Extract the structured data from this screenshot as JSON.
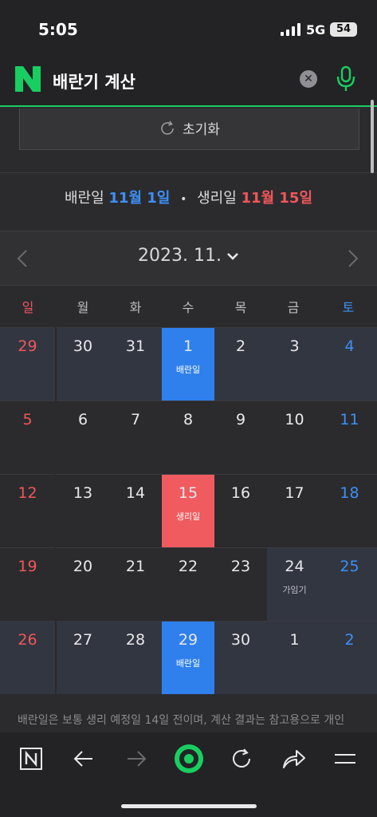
{
  "status": {
    "time": "5:05",
    "network": "5G",
    "battery": "54"
  },
  "search": {
    "query": "배란기 계산",
    "clear_icon": "close-icon",
    "mic_icon": "microphone-icon"
  },
  "reset": {
    "label": "초기화"
  },
  "summary": {
    "ovulation_prefix": "배란일",
    "ovulation_date": "11월 1일",
    "separator": "•",
    "period_prefix": "생리일",
    "period_date": "11월 15일"
  },
  "calendar": {
    "month": "2023. 11.",
    "weekdays": [
      "일",
      "월",
      "화",
      "수",
      "목",
      "금",
      "토"
    ],
    "weeks": [
      [
        {
          "d": "29",
          "out": true
        },
        {
          "d": "30",
          "out": true
        },
        {
          "d": "31",
          "out": true
        },
        {
          "d": "1",
          "mark": "ovu",
          "label": "배란일"
        },
        {
          "d": "2",
          "out": true
        },
        {
          "d": "3",
          "out": true
        },
        {
          "d": "4",
          "out": true
        }
      ],
      [
        {
          "d": "5"
        },
        {
          "d": "6"
        },
        {
          "d": "7"
        },
        {
          "d": "8"
        },
        {
          "d": "9"
        },
        {
          "d": "10"
        },
        {
          "d": "11"
        }
      ],
      [
        {
          "d": "12"
        },
        {
          "d": "13"
        },
        {
          "d": "14"
        },
        {
          "d": "15",
          "mark": "period",
          "label": "생리일"
        },
        {
          "d": "16"
        },
        {
          "d": "17"
        },
        {
          "d": "18"
        }
      ],
      [
        {
          "d": "19"
        },
        {
          "d": "20"
        },
        {
          "d": "21"
        },
        {
          "d": "22"
        },
        {
          "d": "23"
        },
        {
          "d": "24",
          "mark": "fert",
          "label": "가임기"
        },
        {
          "d": "25",
          "mark": "fert"
        }
      ],
      [
        {
          "d": "26",
          "out": true
        },
        {
          "d": "27",
          "out": true
        },
        {
          "d": "28",
          "out": true
        },
        {
          "d": "29",
          "mark": "ovu",
          "label": "배란일"
        },
        {
          "d": "30",
          "out": true
        },
        {
          "d": "1",
          "out": true
        },
        {
          "d": "2",
          "out": true
        }
      ]
    ]
  },
  "note": "배란일은 보통 생리 예정일 14일 전이며, 계산 결과는 참고용으로 개인",
  "colors": {
    "accent_green": "#19ce60",
    "ovulation": "#2f80ec",
    "period": "#ef5b5f",
    "sunday": "#f0565a",
    "saturday": "#3d8ff5"
  }
}
